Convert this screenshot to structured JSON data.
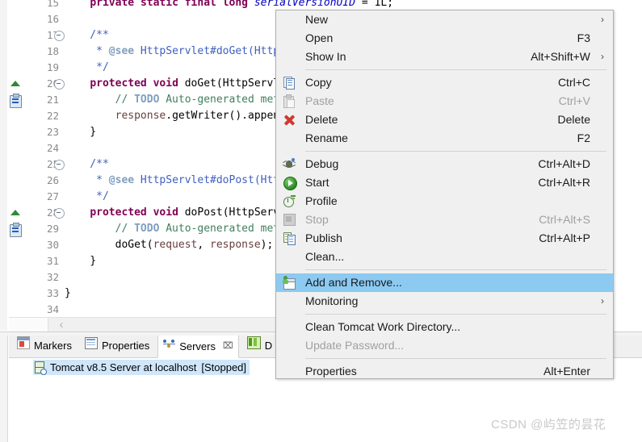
{
  "editor": {
    "lines": [
      {
        "num": "15",
        "fold": false,
        "marker": "",
        "html_key": "l15"
      },
      {
        "num": "16",
        "fold": false,
        "marker": "",
        "html_key": "l16"
      },
      {
        "num": "17",
        "fold": true,
        "marker": "",
        "html_key": "l17"
      },
      {
        "num": "18",
        "fold": false,
        "marker": "",
        "html_key": "l18"
      },
      {
        "num": "19",
        "fold": false,
        "marker": "",
        "html_key": "l19"
      },
      {
        "num": "20",
        "fold": true,
        "marker": "override",
        "html_key": "l20"
      },
      {
        "num": "21",
        "fold": false,
        "marker": "todo",
        "html_key": "l21"
      },
      {
        "num": "22",
        "fold": false,
        "marker": "",
        "html_key": "l22"
      },
      {
        "num": "23",
        "fold": false,
        "marker": "",
        "html_key": "l23"
      },
      {
        "num": "24",
        "fold": false,
        "marker": "",
        "html_key": "l24"
      },
      {
        "num": "25",
        "fold": true,
        "marker": "",
        "html_key": "l25"
      },
      {
        "num": "26",
        "fold": false,
        "marker": "",
        "html_key": "l26"
      },
      {
        "num": "27",
        "fold": false,
        "marker": "",
        "html_key": "l27"
      },
      {
        "num": "28",
        "fold": true,
        "marker": "override",
        "html_key": "l28"
      },
      {
        "num": "29",
        "fold": false,
        "marker": "todo",
        "html_key": "l29"
      },
      {
        "num": "30",
        "fold": false,
        "marker": "",
        "html_key": "l30"
      },
      {
        "num": "31",
        "fold": false,
        "marker": "",
        "html_key": "l31"
      },
      {
        "num": "32",
        "fold": false,
        "marker": "",
        "html_key": "l32"
      },
      {
        "num": "33",
        "fold": false,
        "marker": "",
        "html_key": "l33"
      },
      {
        "num": "34",
        "fold": false,
        "marker": "",
        "html_key": "l34"
      }
    ],
    "code": {
      "l15": "    private static final long serialVersionUID = 1L;",
      "l16": "",
      "l17": "    /**",
      "l18": "     * @see HttpServlet#doGet(HttpServletRequest request, HttpServletResponse resp",
      "l19": "     */",
      "l20": "    protected void doGet(HttpServletRequest request, HttpServletResponse response)",
      "l21": "        // TODO Auto-generated method stub",
      "l22": "        response.getWriter().append(\"Served at: \").append(request.getContextPath()",
      "l23": "    }",
      "l24": "",
      "l25": "    /**",
      "l26": "     * @see HttpServlet#doPost(HttpServletRequest request, HttpServletResponse res",
      "l27": "     */",
      "l28": "    protected void doPost(HttpServletRequest request, HttpServletResponse response",
      "l29": "        // TODO Auto-generated method stub",
      "l30": "        doGet(request, response);",
      "l31": "    }",
      "l32": "",
      "l33": "}",
      "l34": ""
    },
    "scroll_left_arrow": "‹"
  },
  "context_menu": {
    "groups": [
      {
        "items": [
          {
            "label": "New",
            "accel": "",
            "icon": "",
            "submenu": true,
            "disabled": false,
            "highlight": false
          },
          {
            "label": "Open",
            "accel": "F3",
            "icon": "",
            "submenu": false,
            "disabled": false,
            "highlight": false
          },
          {
            "label": "Show In",
            "accel": "Alt+Shift+W",
            "icon": "",
            "submenu": true,
            "disabled": false,
            "highlight": false
          }
        ]
      },
      {
        "items": [
          {
            "label": "Copy",
            "accel": "Ctrl+C",
            "icon": "copy-icon",
            "submenu": false,
            "disabled": false,
            "highlight": false
          },
          {
            "label": "Paste",
            "accel": "Ctrl+V",
            "icon": "paste-icon",
            "submenu": false,
            "disabled": true,
            "highlight": false
          },
          {
            "label": "Delete",
            "accel": "Delete",
            "icon": "delete-icon",
            "submenu": false,
            "disabled": false,
            "highlight": false
          },
          {
            "label": "Rename",
            "accel": "F2",
            "icon": "",
            "submenu": false,
            "disabled": false,
            "highlight": false
          }
        ]
      },
      {
        "items": [
          {
            "label": "Debug",
            "accel": "Ctrl+Alt+D",
            "icon": "debug-icon",
            "submenu": false,
            "disabled": false,
            "highlight": false
          },
          {
            "label": "Start",
            "accel": "Ctrl+Alt+R",
            "icon": "start-icon",
            "submenu": false,
            "disabled": false,
            "highlight": false
          },
          {
            "label": "Profile",
            "accel": "",
            "icon": "profile-icon",
            "submenu": false,
            "disabled": false,
            "highlight": false
          },
          {
            "label": "Stop",
            "accel": "Ctrl+Alt+S",
            "icon": "stop-icon",
            "submenu": false,
            "disabled": true,
            "highlight": false
          },
          {
            "label": "Publish",
            "accel": "Ctrl+Alt+P",
            "icon": "publish-icon",
            "submenu": false,
            "disabled": false,
            "highlight": false
          },
          {
            "label": "Clean...",
            "accel": "",
            "icon": "",
            "submenu": false,
            "disabled": false,
            "highlight": false
          }
        ]
      },
      {
        "items": [
          {
            "label": "Add and Remove...",
            "accel": "",
            "icon": "add-remove-icon",
            "submenu": false,
            "disabled": false,
            "highlight": true
          },
          {
            "label": "Monitoring",
            "accel": "",
            "icon": "",
            "submenu": true,
            "disabled": false,
            "highlight": false
          }
        ]
      },
      {
        "items": [
          {
            "label": "Clean Tomcat Work Directory...",
            "accel": "",
            "icon": "",
            "submenu": false,
            "disabled": false,
            "highlight": false
          },
          {
            "label": "Update Password...",
            "accel": "",
            "icon": "",
            "submenu": false,
            "disabled": true,
            "highlight": false
          }
        ]
      },
      {
        "items": [
          {
            "label": "Properties",
            "accel": "Alt+Enter",
            "icon": "",
            "submenu": false,
            "disabled": false,
            "highlight": false
          }
        ]
      }
    ],
    "submenu_arrow": "›",
    "highlight_color": "#8ccaf2",
    "background_color": "#f0f0f0"
  },
  "bottom_panel": {
    "tabs": [
      {
        "label": "Markers",
        "icon": "markers-icon",
        "active": false,
        "closable": false
      },
      {
        "label": "Properties",
        "icon": "properties-icon",
        "active": false,
        "closable": false
      },
      {
        "label": "Servers",
        "icon": "servers-icon",
        "active": true,
        "closable": true
      },
      {
        "label": "D",
        "icon": "data-source-explorer-icon",
        "active": false,
        "closable": false
      }
    ],
    "close_glyph": "⌧",
    "server_row": {
      "name": "Tomcat v8.5 Server at localhost",
      "status": "[Stopped]",
      "selected_color": "#cfe6fb"
    }
  },
  "watermark": {
    "text": "CSDN @屿笠的昙花"
  }
}
